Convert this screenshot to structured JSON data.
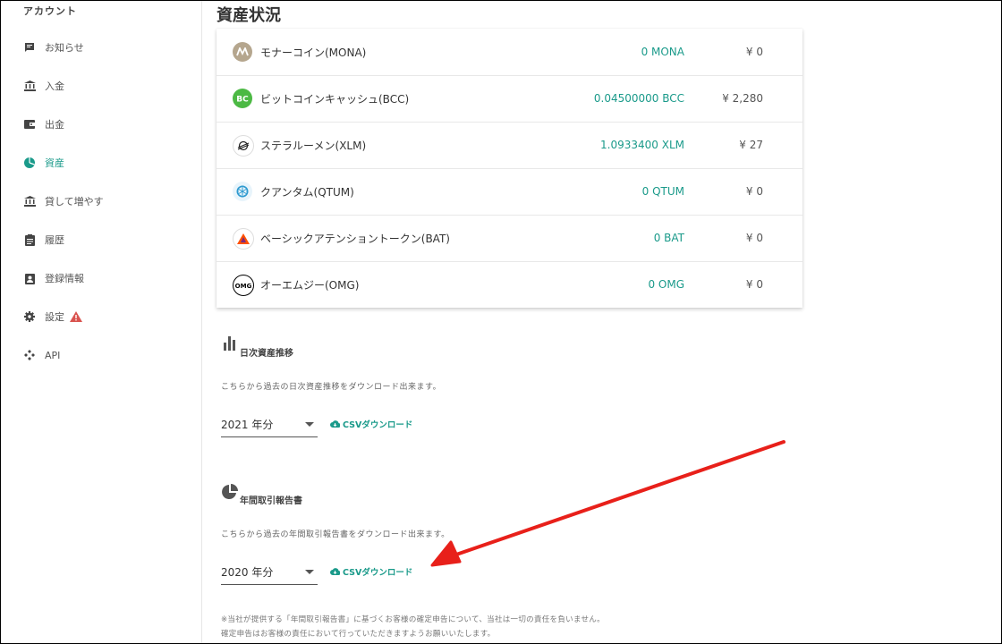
{
  "sidebar": {
    "title": "アカウント",
    "items": [
      {
        "label": "お知らせ",
        "icon": "announcement-icon"
      },
      {
        "label": "入金",
        "icon": "bank-icon"
      },
      {
        "label": "出金",
        "icon": "wallet-icon"
      },
      {
        "label": "資産",
        "icon": "pie-chart-icon",
        "active": true
      },
      {
        "label": "貸して増やす",
        "icon": "bank-icon"
      },
      {
        "label": "履歴",
        "icon": "clipboard-icon"
      },
      {
        "label": "登録情報",
        "icon": "id-badge-icon"
      },
      {
        "label": "設定",
        "icon": "gear-icon",
        "warning": true
      },
      {
        "label": "API",
        "icon": "api-icon"
      }
    ]
  },
  "main": {
    "title": "資産状況",
    "coins": [
      {
        "name": "モナーコイン(MONA)",
        "amount": "0 MONA",
        "jpy": "¥ 0",
        "icon": "mona-icon",
        "color": "#b5a68e"
      },
      {
        "name": "ビットコインキャッシュ(BCC)",
        "amount": "0.04500000 BCC",
        "jpy": "¥ 2,280",
        "icon": "bch-icon",
        "color": "#4cb944"
      },
      {
        "name": "ステラルーメン(XLM)",
        "amount": "1.0933400 XLM",
        "jpy": "¥ 27",
        "icon": "xlm-icon",
        "color": "#222222"
      },
      {
        "name": "クアンタム(QTUM)",
        "amount": "0 QTUM",
        "jpy": "¥ 0",
        "icon": "qtum-icon",
        "color": "#2e9ad0"
      },
      {
        "name": "ベーシックアテンショントークン(BAT)",
        "amount": "0 BAT",
        "jpy": "¥ 0",
        "icon": "bat-icon",
        "color": "#ff5000"
      },
      {
        "name": "オーエムジー(OMG)",
        "amount": "0 OMG",
        "jpy": "¥ 0",
        "icon": "omg-icon",
        "color": "#000000"
      }
    ],
    "daily": {
      "title": "日次資産推移",
      "desc": "こちらから過去の日次資産推移をダウンロード出来ます。",
      "year": "2021 年分",
      "csv": "CSVダウンロード"
    },
    "annual": {
      "title": "年間取引報告書",
      "desc": "こちらから過去の年間取引報告書をダウンロード出来ます。",
      "year": "2020 年分",
      "csv": "CSVダウンロード"
    },
    "notes": [
      "※当社が提供する「年間取引報告書」に基づくお客様の確定申告について、当社は一切の責任を負いません。",
      "確定申告はお客様の責任において行っていただきますようお願いいたします。"
    ]
  },
  "colors": {
    "accent": "#1a9a8a",
    "arrow": "#e8201a",
    "warning": "#d9534f"
  }
}
